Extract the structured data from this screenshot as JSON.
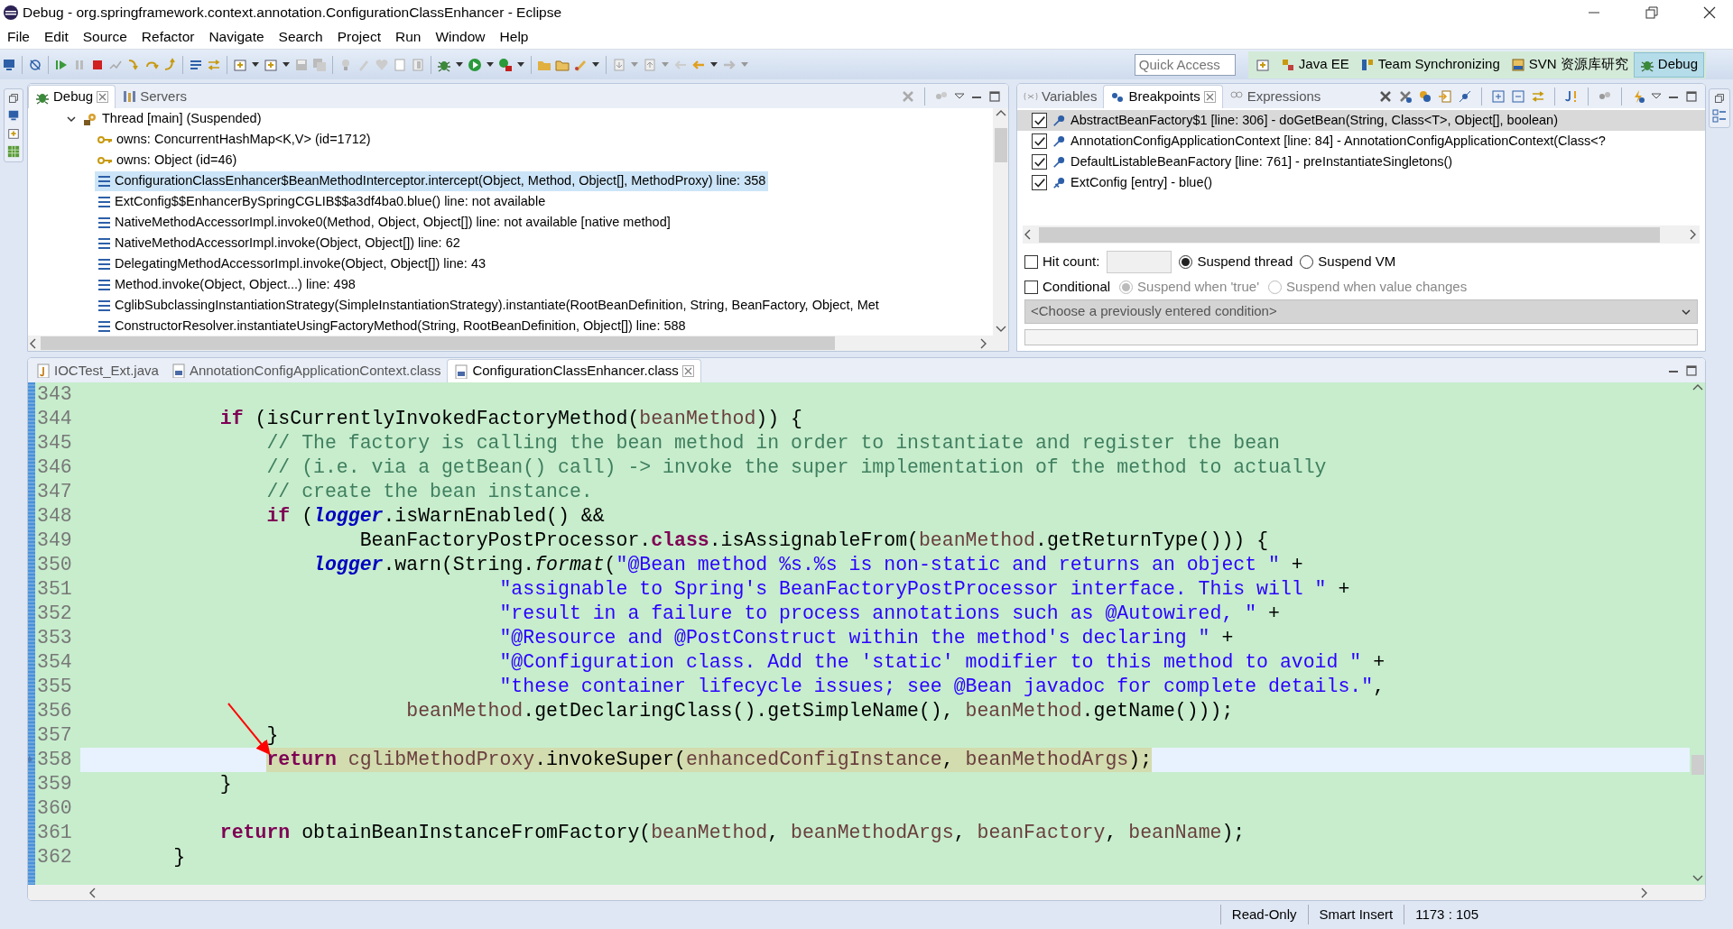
{
  "window": {
    "title": "Debug - org.springframework.context.annotation.ConfigurationClassEnhancer - Eclipse"
  },
  "menu": [
    "File",
    "Edit",
    "Source",
    "Refactor",
    "Navigate",
    "Search",
    "Project",
    "Run",
    "Window",
    "Help"
  ],
  "quick_access": {
    "placeholder": "Quick Access"
  },
  "perspectives": [
    {
      "label": "Java EE",
      "selected": false
    },
    {
      "label": "Team Synchronizing",
      "selected": false
    },
    {
      "label": "SVN 资源库研究",
      "selected": false
    },
    {
      "label": "Debug",
      "selected": true
    }
  ],
  "debug_view": {
    "tabs": [
      {
        "label": "Debug",
        "selected": true
      },
      {
        "label": "Servers",
        "selected": false
      }
    ],
    "thread": {
      "label": "Thread [main] (Suspended)",
      "expanded": true,
      "children": [
        {
          "kind": "monitor",
          "label": "owns: ConcurrentHashMap<K,V>  (id=1712)",
          "selected": false
        },
        {
          "kind": "monitor",
          "label": "owns: Object  (id=46)",
          "selected": false
        },
        {
          "kind": "frame",
          "label": "ConfigurationClassEnhancer$BeanMethodInterceptor.intercept(Object, Method, Object[], MethodProxy) line: 358",
          "selected": true
        },
        {
          "kind": "frame",
          "label": "ExtConfig$$EnhancerBySpringCGLIB$$a3df4ba0.blue() line: not available",
          "selected": false
        },
        {
          "kind": "frame",
          "label": "NativeMethodAccessorImpl.invoke0(Method, Object, Object[]) line: not available [native method]",
          "selected": false
        },
        {
          "kind": "frame",
          "label": "NativeMethodAccessorImpl.invoke(Object, Object[]) line: 62",
          "selected": false
        },
        {
          "kind": "frame",
          "label": "DelegatingMethodAccessorImpl.invoke(Object, Object[]) line: 43",
          "selected": false
        },
        {
          "kind": "frame",
          "label": "Method.invoke(Object, Object...) line: 498",
          "selected": false
        },
        {
          "kind": "frame",
          "label": "CglibSubclassingInstantiationStrategy(SimpleInstantiationStrategy).instantiate(RootBeanDefinition, String, BeanFactory, Object, Met",
          "selected": false
        },
        {
          "kind": "frame",
          "label": "ConstructorResolver.instantiateUsingFactoryMethod(String, RootBeanDefinition, Object[]) line: 588",
          "selected": false
        }
      ]
    }
  },
  "breakpoints_view": {
    "tabs": [
      {
        "label": "Variables",
        "selected": false
      },
      {
        "label": "Breakpoints",
        "selected": true
      },
      {
        "label": "Expressions",
        "selected": false
      }
    ],
    "breakpoints": [
      {
        "kind": "line",
        "label": "AbstractBeanFactory$1 [line: 306] - doGetBean(String, Class<T>, Object[], boolean)",
        "checked": true,
        "selected": true
      },
      {
        "kind": "line",
        "label": "AnnotationConfigApplicationContext [line: 84] - AnnotationConfigApplicationContext(Class<?",
        "checked": true,
        "selected": false
      },
      {
        "kind": "line",
        "label": "DefaultListableBeanFactory [line: 761] - preInstantiateSingletons()",
        "checked": true,
        "selected": false
      },
      {
        "kind": "method",
        "label": "ExtConfig [entry] - blue()",
        "checked": true,
        "selected": false
      }
    ],
    "hit_count": {
      "label": "Hit count:",
      "checked": false
    },
    "suspend_options": [
      {
        "label": "Suspend thread",
        "selected": true
      },
      {
        "label": "Suspend VM",
        "selected": false
      }
    ],
    "conditional": {
      "label": "Conditional",
      "checked": false
    },
    "condition_options": [
      {
        "label": "Suspend when 'true'",
        "selected": true,
        "disabled": true
      },
      {
        "label": "Suspend when value changes",
        "selected": false,
        "disabled": true
      }
    ],
    "condition_select": {
      "placeholder": "<Choose a previously entered condition>",
      "disabled": true
    }
  },
  "editor": {
    "tabs": [
      {
        "kind": "java",
        "label": "IOCTest_Ext.java",
        "selected": false
      },
      {
        "kind": "class",
        "label": "AnnotationConfigApplicationContext.class",
        "selected": false
      },
      {
        "kind": "class",
        "label": "ConfigurationClassEnhancer.class",
        "selected": true
      }
    ],
    "lines": [
      {
        "number": "343"
      },
      {
        "number": "344",
        "code": [
          {
            "kind": "keyword",
            "text": "            if"
          },
          {
            "kind": "plain",
            "text": " (isCurrentlyInvokedFactoryMethod("
          },
          {
            "kind": "variable",
            "text": "beanMethod"
          },
          {
            "kind": "plain",
            "text": ")) {"
          }
        ]
      },
      {
        "number": "345",
        "code": [
          {
            "kind": "comment",
            "text": "                // The factory is calling the bean method in order to instantiate and register the bean"
          }
        ]
      },
      {
        "number": "346",
        "code": [
          {
            "kind": "comment",
            "text": "                // (i.e. via a getBean() call) -> invoke the super implementation of the method to actually"
          }
        ]
      },
      {
        "number": "347",
        "code": [
          {
            "kind": "comment",
            "text": "                // create the bean instance."
          }
        ]
      },
      {
        "number": "348",
        "code": [
          {
            "kind": "keyword",
            "text": "                if"
          },
          {
            "kind": "plain",
            "text": " ("
          },
          {
            "kind": "field",
            "text": "logger"
          },
          {
            "kind": "plain",
            "text": ".isWarnEnabled() &&"
          }
        ]
      },
      {
        "number": "349",
        "code": [
          {
            "kind": "plain",
            "text": "                        BeanFactoryPostProcessor."
          },
          {
            "kind": "keyword",
            "text": "class"
          },
          {
            "kind": "plain",
            "text": ".isAssignableFrom("
          },
          {
            "kind": "variable",
            "text": "beanMethod"
          },
          {
            "kind": "plain",
            "text": ".getReturnType())) {"
          }
        ]
      },
      {
        "number": "350",
        "code": [
          {
            "kind": "field",
            "text": "                    logger"
          },
          {
            "kind": "plain",
            "text": ".warn(String."
          },
          {
            "kind": "method",
            "text": "format"
          },
          {
            "kind": "plain",
            "text": "("
          },
          {
            "kind": "string",
            "text": "\"@Bean method %s.%s is non-static and returns an object \""
          },
          {
            "kind": "plain",
            "text": " +"
          }
        ]
      },
      {
        "number": "351",
        "code": [
          {
            "kind": "string",
            "text": "                                    \"assignable to Spring's BeanFactoryPostProcessor interface. This will \""
          },
          {
            "kind": "plain",
            "text": " +"
          }
        ]
      },
      {
        "number": "352",
        "code": [
          {
            "kind": "string",
            "text": "                                    \"result in a failure to process annotations such as @Autowired, \""
          },
          {
            "kind": "plain",
            "text": " +"
          }
        ]
      },
      {
        "number": "353",
        "code": [
          {
            "kind": "string",
            "text": "                                    \"@Resource and @PostConstruct within the method's declaring \""
          },
          {
            "kind": "plain",
            "text": " +"
          }
        ]
      },
      {
        "number": "354",
        "code": [
          {
            "kind": "string",
            "text": "                                    \"@Configuration class. Add the 'static' modifier to this method to avoid \""
          },
          {
            "kind": "plain",
            "text": " +"
          }
        ]
      },
      {
        "number": "355",
        "code": [
          {
            "kind": "string",
            "text": "                                    \"these container lifecycle issues; see @Bean javadoc for complete details.\""
          },
          {
            "kind": "plain",
            "text": ","
          }
        ]
      },
      {
        "number": "356",
        "code": [
          {
            "kind": "variable",
            "text": "                            beanMethod"
          },
          {
            "kind": "plain",
            "text": ".getDeclaringClass().getSimpleName(), "
          },
          {
            "kind": "variable",
            "text": "beanMethod"
          },
          {
            "kind": "plain",
            "text": ".getName()));"
          }
        ]
      },
      {
        "number": "357",
        "code": [
          {
            "kind": "plain",
            "text": "                }"
          }
        ]
      },
      {
        "number": "358",
        "current": true,
        "code": [
          {
            "kind": "keyword",
            "text": "                return "
          },
          {
            "kind": "variable",
            "text": "cglibMethodProxy"
          },
          {
            "kind": "plain",
            "text": ".invokeSuper("
          },
          {
            "kind": "variable",
            "text": "enhancedConfigInstance"
          },
          {
            "kind": "plain",
            "text": ", "
          },
          {
            "kind": "variable",
            "text": "beanMethodArgs"
          },
          {
            "kind": "plain",
            "text": ");"
          }
        ]
      },
      {
        "number": "359",
        "code": [
          {
            "kind": "plain",
            "text": "            }"
          }
        ]
      },
      {
        "number": "360"
      },
      {
        "number": "361",
        "code": [
          {
            "kind": "keyword",
            "text": "            return"
          },
          {
            "kind": "plain",
            "text": " obtainBeanInstanceFromFactory("
          },
          {
            "kind": "variable",
            "text": "beanMethod"
          },
          {
            "kind": "plain",
            "text": ", "
          },
          {
            "kind": "variable",
            "text": "beanMethodArgs"
          },
          {
            "kind": "plain",
            "text": ", "
          },
          {
            "kind": "variable",
            "text": "beanFactory"
          },
          {
            "kind": "plain",
            "text": ", "
          },
          {
            "kind": "variable",
            "text": "beanName"
          },
          {
            "kind": "plain",
            "text": ");"
          }
        ]
      },
      {
        "number": "362",
        "code": [
          {
            "kind": "plain",
            "text": "        }"
          }
        ]
      }
    ]
  },
  "status_bar": [
    "Read-Only",
    "Smart Insert",
    "1173 : 105"
  ]
}
